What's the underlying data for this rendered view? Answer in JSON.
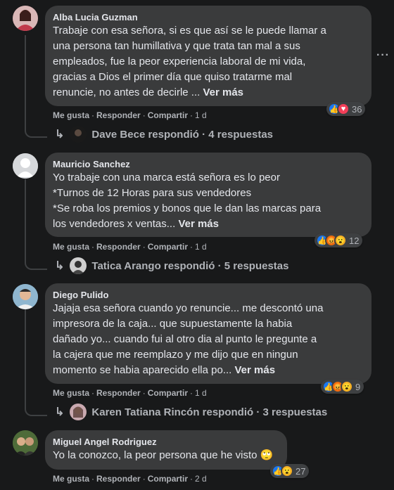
{
  "comments": [
    {
      "author": "Alba Lucia Guzman",
      "text": "Trabaje con esa señora, si es que así se le puede llamar a\nuna persona tan humillativa y que trata tan mal a sus\nempleados, fue la peor experiencia laboral de mi vida,\ngracias a Dios el primer día que quiso tratarme mal\nrenuncie, no antes de decirle ...",
      "more": "Ver más",
      "like": "Me gusta",
      "reply": "Responder",
      "share": "Compartir",
      "time": "1 d",
      "reaction_count": "36",
      "reactions": [
        "like-icon",
        "love-icon"
      ],
      "replies_text": "Dave Bece respondió · 4 respuestas"
    },
    {
      "author": "Mauricio Sanchez",
      "text": "Yo trabaje con una marca está señora es lo peor\n*Turnos de 12 Horas para sus vendedores\n*Se roba los premios y bonos que le dan las marcas para\nlos vendedores x ventas...",
      "more": "Ver más",
      "like": "Me gusta",
      "reply": "Responder",
      "share": "Compartir",
      "time": "1 d",
      "reaction_count": "12",
      "reactions": [
        "like-icon",
        "angry-icon",
        "wow-icon"
      ],
      "replies_text": "Tatica Arango respondió · 5 respuestas"
    },
    {
      "author": "Diego Pulido",
      "text": "Jajaja esa señora cuando yo renuncie... me descontó una\nimpresora de la caja... que supuestamente la habia\ndañado yo... cuando fui al otro dia al punto le pregunte a\nla cajera que me reemplazo y me dijo que en ningun\nmomento se habia aparecido ella po...",
      "more": "Ver más",
      "like": "Me gusta",
      "reply": "Responder",
      "share": "Compartir",
      "time": "1 d",
      "reaction_count": "9",
      "reactions": [
        "like-icon",
        "angry-icon",
        "wow-icon"
      ],
      "replies_text": "Karen Tatiana Rincón respondió · 3 respuestas"
    },
    {
      "author": "Miguel Angel Rodriguez",
      "text": "Yo la conozco, la peor persona que he visto 🙄",
      "like": "Me gusta",
      "reply": "Responder",
      "share": "Compartir",
      "time": "2 d",
      "reaction_count": "27",
      "reactions": [
        "like-icon",
        "wow-icon"
      ]
    }
  ],
  "menu_icon": "more-options-icon"
}
